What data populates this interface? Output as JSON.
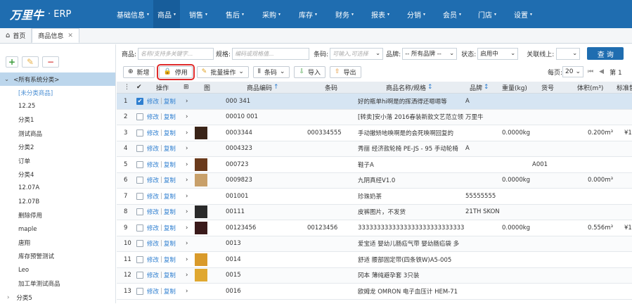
{
  "logo": {
    "brand": "万里牛",
    "suffix": "· ERP"
  },
  "topnav": [
    {
      "label": "基础信息",
      "active": false
    },
    {
      "label": "商品",
      "active": true
    },
    {
      "label": "销售",
      "active": false
    },
    {
      "label": "售后",
      "active": false
    },
    {
      "label": "采购",
      "active": false
    },
    {
      "label": "库存",
      "active": false
    },
    {
      "label": "财务",
      "active": false
    },
    {
      "label": "报表",
      "active": false
    },
    {
      "label": "分销",
      "active": false
    },
    {
      "label": "会员",
      "active": false
    },
    {
      "label": "门店",
      "active": false
    },
    {
      "label": "设置",
      "active": false
    }
  ],
  "tabs": [
    {
      "label": "首页"
    },
    {
      "label": "商品信息"
    }
  ],
  "sidebar": {
    "root": "<所有系统分类>",
    "items": [
      "[未分类商品]",
      "12.25",
      "分类1",
      "测试商品",
      "分类2",
      "订单",
      "分类4",
      "12.07A",
      "12.07B",
      "删除停用",
      "maple",
      "唐翔",
      "库存预警测试",
      "Leo",
      "加工单测试商品",
      "分类5"
    ]
  },
  "filter": {
    "product_label": "商品:",
    "product_placeholder": "名称/支持多关键字...",
    "spec_label": "规格:",
    "spec_placeholder": "编码或规格值...",
    "barcode_label": "条码:",
    "barcode_placeholder": "可输入,可选择",
    "brand_label": "品牌:",
    "brand_value": "-- 所有品牌 --",
    "status_label": "状态:",
    "status_value": "启用中",
    "online_label": "关联线上:",
    "online_value": "",
    "search_label": "查 询"
  },
  "toolbar": {
    "add": "新增",
    "disable": "停用",
    "batch": "批量操作",
    "barcode": "条码",
    "import": "导入",
    "export": "导出"
  },
  "pager": {
    "per_page_label": "每页:",
    "per_page": "20",
    "page_label": "第 1"
  },
  "columns": {
    "op": "操作",
    "img": "图",
    "code": "商品编码",
    "barcode": "条码",
    "name": "商品名称/规格",
    "brand": "品牌",
    "weight": "重量(kg)",
    "sku": "货号",
    "volume": "体积(m³)",
    "price": "标准售"
  },
  "rows": [
    {
      "no": "1",
      "checked": true,
      "edit": "修改",
      "copy": "复制",
      "img": "",
      "code": "000 341",
      "barcode": "",
      "name": "好的瓶单hi啊是的挥洒得还嗯嗯等",
      "brand": "A",
      "weight": "",
      "sku": "",
      "volume": "",
      "price": ""
    },
    {
      "no": "2",
      "checked": false,
      "edit": "修改",
      "copy": "复制",
      "img": "",
      "code": "00010 001",
      "barcode": "",
      "name": "[转卖]安小落 2016春装新款文艺范立领",
      "brand": "万里牛",
      "weight": "",
      "sku": "",
      "volume": "",
      "price": ""
    },
    {
      "no": "3",
      "checked": false,
      "edit": "修改",
      "copy": "复制",
      "img": "#3a2418",
      "code": "0003344",
      "barcode": "000334555",
      "name": "手动撤矫地唤啊是的会死唤啊回复的",
      "brand": "",
      "weight": "0.0000kg",
      "sku": "",
      "volume": "0.200m³",
      "price": "¥1"
    },
    {
      "no": "4",
      "checked": false,
      "edit": "修改",
      "copy": "复制",
      "img": "",
      "code": "0004323",
      "barcode": "",
      "name": "秀丽 经济款轮椅 PE-JS - 95 手动轮椅",
      "brand": "A",
      "weight": "",
      "sku": "",
      "volume": "",
      "price": ""
    },
    {
      "no": "5",
      "checked": false,
      "edit": "修改",
      "copy": "复制",
      "img": "#6a3a1c",
      "code": "000723",
      "barcode": "",
      "name": "鞋子A",
      "brand": "",
      "weight": "",
      "sku": "A001",
      "volume": "",
      "price": ""
    },
    {
      "no": "6",
      "checked": false,
      "edit": "修改",
      "copy": "复制",
      "img": "#c8a06a",
      "code": "0009823",
      "barcode": "",
      "name": "九阴真经V1.0",
      "brand": "",
      "weight": "0.0000kg",
      "sku": "",
      "volume": "0.000m³",
      "price": ""
    },
    {
      "no": "7",
      "checked": false,
      "edit": "修改",
      "copy": "复制",
      "img": "",
      "code": "001001",
      "barcode": "",
      "name": "珍珠奶茶",
      "brand": "55555555",
      "weight": "",
      "sku": "",
      "volume": "",
      "price": ""
    },
    {
      "no": "8",
      "checked": false,
      "edit": "修改",
      "copy": "复制",
      "img": "#2a2a2a",
      "code": "00111",
      "barcode": "",
      "name": "皮裤图片，不发货",
      "brand": "21TH SKON",
      "weight": "",
      "sku": "",
      "volume": "",
      "price": ""
    },
    {
      "no": "9",
      "checked": false,
      "edit": "修改",
      "copy": "复制",
      "img": "#3a1a1a",
      "code": "00123456",
      "barcode": "00123456",
      "name": "333333333333333333333333333333",
      "brand": "",
      "weight": "0.0000kg",
      "sku": "",
      "volume": "0.556m³",
      "price": "¥1"
    },
    {
      "no": "10",
      "checked": false,
      "edit": "修改",
      "copy": "复制",
      "img": "",
      "code": "0013",
      "barcode": "",
      "name": "爱宝适 婴幼儿肠疝气带 婴幼肠疝袋 多",
      "brand": "",
      "weight": "",
      "sku": "",
      "volume": "",
      "price": ""
    },
    {
      "no": "11",
      "checked": false,
      "edit": "修改",
      "copy": "复制",
      "img": "#d99a2a",
      "code": "0014",
      "barcode": "",
      "name": "舒适 腰部固定带(四条铁W)A5-005",
      "brand": "",
      "weight": "",
      "sku": "",
      "volume": "",
      "price": ""
    },
    {
      "no": "12",
      "checked": false,
      "edit": "修改",
      "copy": "复制",
      "img": "#e0a830",
      "code": "0015",
      "barcode": "",
      "name": "冈本 薄纯避孕套 3只装",
      "brand": "",
      "weight": "",
      "sku": "",
      "volume": "",
      "price": ""
    },
    {
      "no": "13",
      "checked": false,
      "edit": "修改",
      "copy": "复制",
      "img": "",
      "code": "0016",
      "barcode": "",
      "name": "欧姆龙 OMRON 电子血压计 HEM-71",
      "brand": "",
      "weight": "",
      "sku": "",
      "volume": "",
      "price": ""
    }
  ]
}
